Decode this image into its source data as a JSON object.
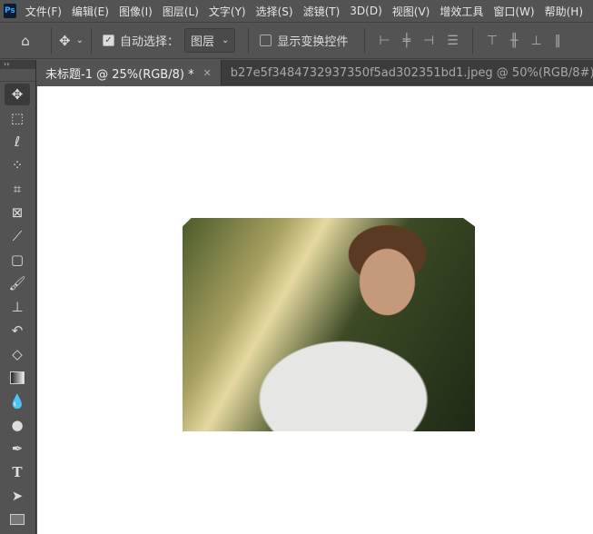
{
  "app": {
    "logo": "Ps"
  },
  "menu": [
    "文件(F)",
    "编辑(E)",
    "图像(I)",
    "图层(L)",
    "文字(Y)",
    "选择(S)",
    "滤镜(T)",
    "3D(D)",
    "视图(V)",
    "增效工具",
    "窗口(W)",
    "帮助(H)"
  ],
  "options": {
    "auto_select_label": "自动选择：",
    "auto_select_checked": true,
    "layer_select": "图层",
    "show_transform_label": "显示变换控件",
    "show_transform_checked": false
  },
  "tabs": [
    {
      "label": "未标题-1 @ 25%(RGB/8) *",
      "active": true
    },
    {
      "label": "b27e5f3484732937350f5ad302351bd1.jpeg @ 50%(RGB/8#)",
      "active": false
    }
  ],
  "tools": [
    "move-tool",
    "marquee-tool",
    "lasso-tool",
    "quick-select-tool",
    "crop-tool",
    "frame-tool",
    "eyedropper-tool",
    "patch-tool",
    "brush-tool",
    "stamp-tool",
    "history-brush-tool",
    "eraser-tool",
    "gradient-tool",
    "blur-tool",
    "dodge-tool",
    "pen-tool",
    "type-tool",
    "path-select-tool",
    "rectangle-tool"
  ]
}
